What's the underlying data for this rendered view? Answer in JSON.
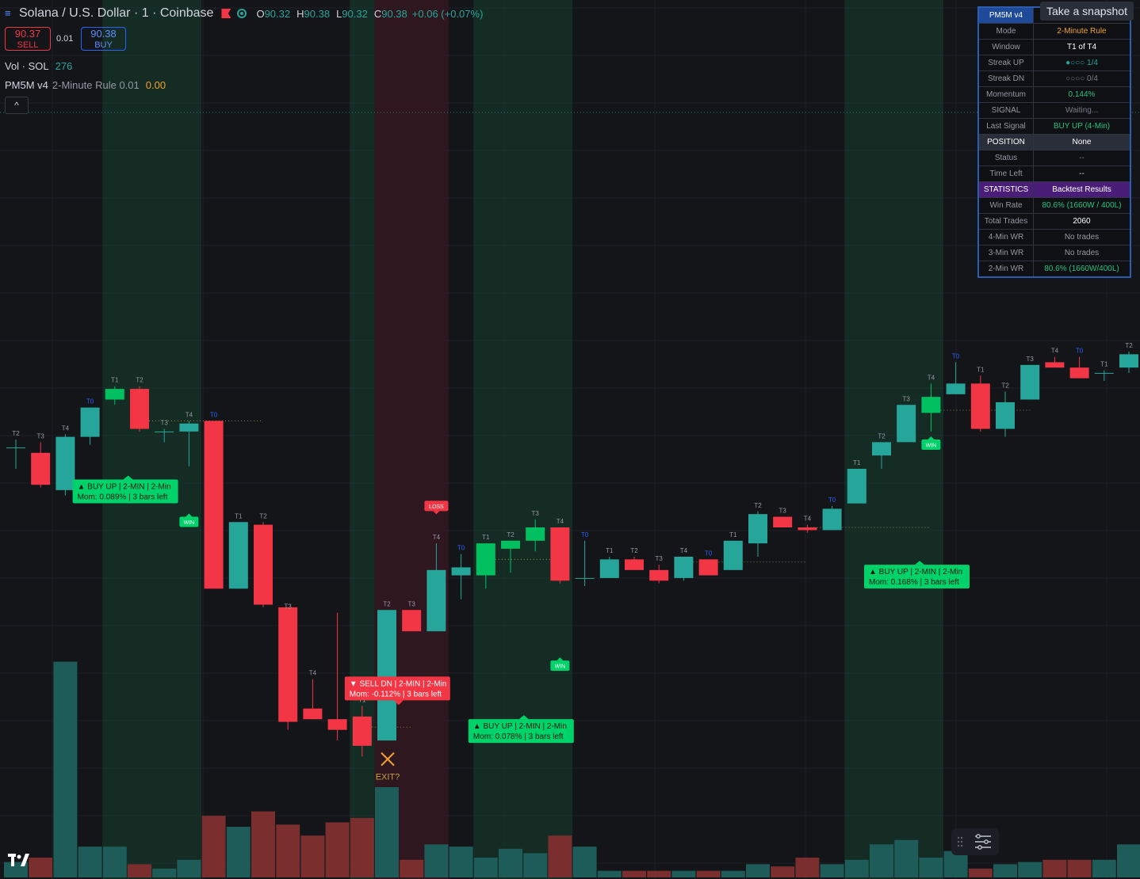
{
  "header": {
    "symbol_title": "Solana / U.S. Dollar · 1 · Coinbase",
    "ohlc": [
      {
        "k": "O",
        "v": "90.32"
      },
      {
        "k": "H",
        "v": "90.38"
      },
      {
        "k": "L",
        "v": "90.32"
      },
      {
        "k": "C",
        "v": "90.38"
      }
    ],
    "change": "+0.06 (+0.07%)",
    "sell_price": "90.37",
    "sell_label": "SELL",
    "spread": "0.01",
    "buy_price": "90.38",
    "buy_label": "BUY",
    "volume_label": "Vol · SOL",
    "volume_value": "276",
    "indicator_label": "PM5M v4",
    "indicator_params": "2-Minute Rule 0.01",
    "indicator_value": "0.00",
    "collapse_glyph": "^"
  },
  "snapshot_tooltip": "Take a snapshot",
  "pm_table": {
    "rows": [
      {
        "label": "PM5M v4",
        "value": "",
        "kind": "hdr"
      },
      {
        "label": "Mode",
        "value": "2-Minute Rule",
        "color": "#f0a030"
      },
      {
        "label": "Window",
        "value": "T1 of T4",
        "color": "#ffffff"
      },
      {
        "label": "Streak UP",
        "value": "●○○○  1/4",
        "color": "#26a69a"
      },
      {
        "label": "Streak DN",
        "value": "○○○○  0/4",
        "color": "#787b86"
      },
      {
        "label": "Momentum",
        "value": "0.144%",
        "color": "#26c281"
      },
      {
        "label": "SIGNAL",
        "value": "Waiting...",
        "color": "#787b86"
      },
      {
        "label": "Last Signal",
        "value": "BUY UP  (4-Min)",
        "color": "#26c281"
      },
      {
        "label": "POSITION",
        "value": "None",
        "kind": "pos"
      },
      {
        "label": "Status",
        "value": "--",
        "color": "#787b86"
      },
      {
        "label": "Time Left",
        "value": "--",
        "color": "#d1d4dc"
      },
      {
        "label": "STATISTICS",
        "value": "Backtest Results",
        "kind": "stat"
      },
      {
        "label": "Win Rate",
        "value": "80.6%  (1660W / 400L)",
        "color": "#26c281"
      },
      {
        "label": "Total Trades",
        "value": "2060",
        "color": "#ffffff"
      },
      {
        "label": "4-Min WR",
        "value": "No trades",
        "color": "#9598a1"
      },
      {
        "label": "3-Min WR",
        "value": "No trades",
        "color": "#9598a1"
      },
      {
        "label": "2-Min WR",
        "value": "80.6%  (1660W/400L)",
        "color": "#26c281"
      }
    ]
  },
  "chart_data": {
    "type": "candlestick",
    "colors": {
      "up": "#26a69a",
      "up_strong": "#00c060",
      "down": "#f23645",
      "vol_up": "#1d5c58",
      "vol_down": "#7a2e2e"
    },
    "price_range": [
      88.4,
      91.7
    ],
    "candles": [
      {
        "o": 90.02,
        "h": 90.05,
        "l": 89.94,
        "c": 90.02,
        "lbl": "T2"
      },
      {
        "o": 90.0,
        "h": 90.04,
        "l": 89.87,
        "c": 89.88,
        "lbl": "T3"
      },
      {
        "o": 89.86,
        "h": 90.07,
        "l": 89.84,
        "c": 90.06,
        "lbl": "T4"
      },
      {
        "o": 90.06,
        "h": 90.17,
        "l": 90.03,
        "c": 90.17,
        "lbl": "T0"
      },
      {
        "o": 90.2,
        "h": 90.25,
        "l": 90.18,
        "c": 90.24,
        "lbl": "T1",
        "strong": true
      },
      {
        "o": 90.24,
        "h": 90.25,
        "l": 90.08,
        "c": 90.09,
        "lbl": "T2"
      },
      {
        "o": 90.08,
        "h": 90.09,
        "l": 90.04,
        "c": 90.08,
        "lbl": "T3"
      },
      {
        "o": 90.08,
        "h": 90.12,
        "l": 89.95,
        "c": 90.11,
        "lbl": "T4"
      },
      {
        "o": 90.12,
        "h": 90.12,
        "l": 89.49,
        "c": 89.49,
        "lbl": "T0"
      },
      {
        "o": 89.49,
        "h": 89.74,
        "l": 89.49,
        "c": 89.74,
        "lbl": "T1"
      },
      {
        "o": 89.73,
        "h": 89.74,
        "l": 89.42,
        "c": 89.43,
        "lbl": "T2"
      },
      {
        "o": 89.42,
        "h": 89.4,
        "l": 88.96,
        "c": 88.99,
        "lbl": "T3"
      },
      {
        "o": 89.04,
        "h": 89.15,
        "l": 89.0,
        "c": 89.0,
        "lbl": "T4"
      },
      {
        "o": 89.0,
        "h": 89.4,
        "l": 88.92,
        "c": 88.96,
        "lbl": ""
      },
      {
        "o": 89.01,
        "h": 89.05,
        "l": 88.86,
        "c": 88.9,
        "lbl": "T1"
      },
      {
        "o": 88.92,
        "h": 89.41,
        "l": 88.92,
        "c": 89.41,
        "lbl": "T2"
      },
      {
        "o": 89.41,
        "h": 89.41,
        "l": 89.33,
        "c": 89.33,
        "lbl": "T3"
      },
      {
        "o": 89.33,
        "h": 89.66,
        "l": 89.33,
        "c": 89.56,
        "lbl": "T4"
      },
      {
        "o": 89.54,
        "h": 89.62,
        "l": 89.45,
        "c": 89.57,
        "lbl": "T0"
      },
      {
        "o": 89.54,
        "h": 89.66,
        "l": 89.49,
        "c": 89.66,
        "lbl": "T1",
        "strong": true
      },
      {
        "o": 89.64,
        "h": 89.67,
        "l": 89.55,
        "c": 89.67,
        "lbl": "T2",
        "strong": true
      },
      {
        "o": 89.67,
        "h": 89.75,
        "l": 89.63,
        "c": 89.72,
        "lbl": "T3",
        "strong": true
      },
      {
        "o": 89.72,
        "h": 89.72,
        "l": 89.51,
        "c": 89.52,
        "lbl": "T4"
      },
      {
        "o": 89.53,
        "h": 89.67,
        "l": 89.5,
        "c": 89.53,
        "lbl": "T0"
      },
      {
        "o": 89.53,
        "h": 89.61,
        "l": 89.53,
        "c": 89.6,
        "lbl": "T1"
      },
      {
        "o": 89.6,
        "h": 89.61,
        "l": 89.56,
        "c": 89.56,
        "lbl": "T2"
      },
      {
        "o": 89.56,
        "h": 89.58,
        "l": 89.51,
        "c": 89.52,
        "lbl": "T3"
      },
      {
        "o": 89.53,
        "h": 89.61,
        "l": 89.52,
        "c": 89.61,
        "lbl": "T4"
      },
      {
        "o": 89.6,
        "h": 89.6,
        "l": 89.54,
        "c": 89.54,
        "lbl": "T0"
      },
      {
        "o": 89.56,
        "h": 89.67,
        "l": 89.56,
        "c": 89.67,
        "lbl": "T1"
      },
      {
        "o": 89.66,
        "h": 89.78,
        "l": 89.61,
        "c": 89.77,
        "lbl": "T2"
      },
      {
        "o": 89.76,
        "h": 89.76,
        "l": 89.72,
        "c": 89.72,
        "lbl": "T3"
      },
      {
        "o": 89.72,
        "h": 89.73,
        "l": 89.7,
        "c": 89.71,
        "lbl": "T4"
      },
      {
        "o": 89.71,
        "h": 89.8,
        "l": 89.71,
        "c": 89.79,
        "lbl": "T0"
      },
      {
        "o": 89.81,
        "h": 89.94,
        "l": 89.81,
        "c": 89.94,
        "lbl": "T1"
      },
      {
        "o": 89.99,
        "h": 90.04,
        "l": 89.94,
        "c": 90.04,
        "lbl": "T2"
      },
      {
        "o": 90.04,
        "h": 90.18,
        "l": 90.04,
        "c": 90.18,
        "lbl": "T3"
      },
      {
        "o": 90.15,
        "h": 90.26,
        "l": 90.08,
        "c": 90.21,
        "lbl": "T4",
        "strong": true
      },
      {
        "o": 90.22,
        "h": 90.34,
        "l": 90.22,
        "c": 90.26,
        "lbl": "T0"
      },
      {
        "o": 90.26,
        "h": 90.29,
        "l": 90.08,
        "c": 90.09,
        "lbl": "T1"
      },
      {
        "o": 90.09,
        "h": 90.23,
        "l": 90.06,
        "c": 90.19,
        "lbl": "T2"
      },
      {
        "o": 90.2,
        "h": 90.33,
        "l": 90.2,
        "c": 90.33,
        "lbl": "T3"
      },
      {
        "o": 90.34,
        "h": 90.36,
        "l": 90.32,
        "c": 90.32,
        "lbl": "T4"
      },
      {
        "o": 90.32,
        "h": 90.36,
        "l": 90.28,
        "c": 90.28,
        "lbl": "T0"
      },
      {
        "o": 90.3,
        "h": 90.31,
        "l": 90.27,
        "c": 90.3,
        "lbl": "T1"
      },
      {
        "o": 90.32,
        "h": 90.38,
        "l": 90.3,
        "c": 90.37,
        "lbl": "T2"
      }
    ],
    "volumes": [
      0.07,
      0.09,
      0.98,
      0.14,
      0.14,
      0.06,
      0.04,
      0.08,
      0.28,
      0.23,
      0.3,
      0.24,
      0.19,
      0.25,
      0.27,
      0.41,
      0.08,
      0.15,
      0.14,
      0.09,
      0.13,
      0.11,
      0.19,
      0.14,
      0.03,
      0.03,
      0.03,
      0.03,
      0.03,
      0.03,
      0.06,
      0.05,
      0.09,
      0.06,
      0.08,
      0.15,
      0.17,
      0.09,
      0.12,
      0.04,
      0.06,
      0.07,
      0.08,
      0.08,
      0.08,
      0.15
    ],
    "bands": [
      {
        "from": 4,
        "to": 7,
        "kind": "up"
      },
      {
        "from": 14,
        "to": 14,
        "kind": "up"
      },
      {
        "from": 15,
        "to": 17,
        "kind": "down"
      },
      {
        "from": 19,
        "to": 22,
        "kind": "up"
      },
      {
        "from": 34,
        "to": 37,
        "kind": "up"
      }
    ],
    "signals": [
      {
        "text": "▲ BUY UP | 2-MIN | 2-Min",
        "text2": "Mom: 0.089% | 3 bars left",
        "kind": "buy",
        "bar": 3,
        "price": 89.9
      },
      {
        "text": "▼ SELL DN | 2-MIN | 2-Min",
        "text2": "Mom: -0.112% | 3 bars left",
        "kind": "sell",
        "bar": 14,
        "price": 89.16
      },
      {
        "text": "▲ BUY UP | 2-MIN | 2-Min",
        "text2": "Mom: 0.078% | 3 bars left",
        "kind": "buy",
        "bar": 19,
        "price": 89.0
      },
      {
        "text": "▲ BUY UP | 2-MIN | 2-Min",
        "text2": "Mom: 0.168% | 3 bars left",
        "kind": "buy",
        "bar": 35,
        "price": 89.58
      }
    ],
    "results": [
      {
        "text": "WIN",
        "kind": "win",
        "bar": 7,
        "price": 89.76
      },
      {
        "text": "LOSS",
        "kind": "loss",
        "bar": 17,
        "price": 89.82
      },
      {
        "text": "WIN",
        "kind": "win",
        "bar": 22,
        "price": 89.22
      },
      {
        "text": "WIN",
        "kind": "win",
        "bar": 37,
        "price": 90.05
      }
    ],
    "exit_marker": {
      "text": "EXIT?",
      "bar": 15,
      "price": 88.85
    }
  }
}
